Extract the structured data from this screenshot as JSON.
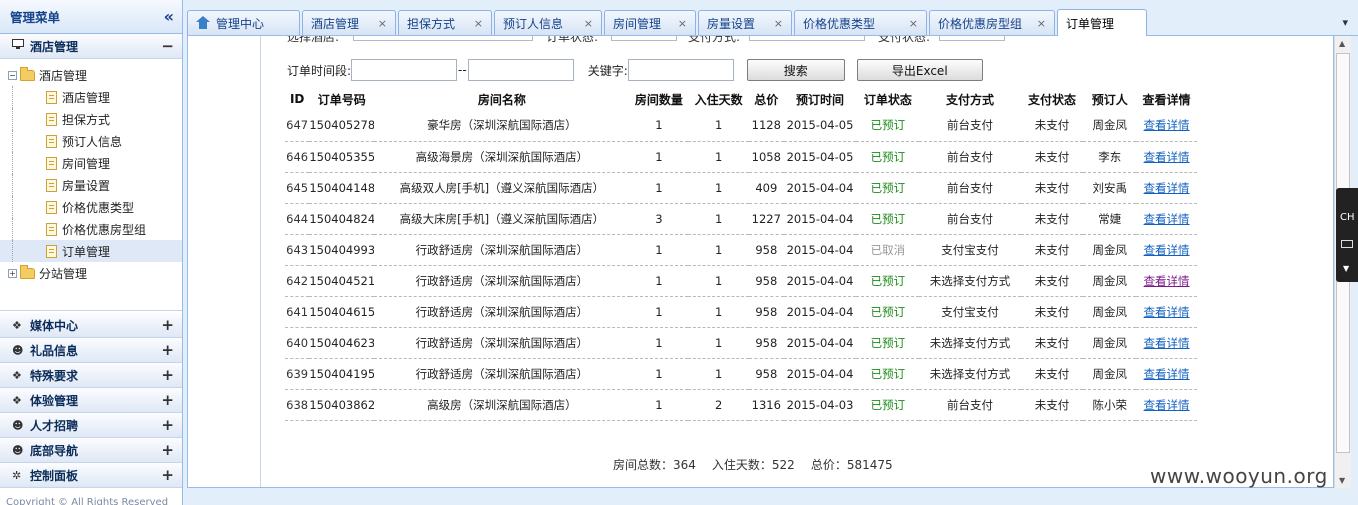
{
  "sidebar": {
    "title": "管理菜单",
    "collapse_glyph": "«",
    "active_section": {
      "label": "酒店管理",
      "toggle": "−"
    },
    "tree": {
      "root": {
        "label": "酒店管理",
        "expander": "−"
      },
      "children": [
        "酒店管理",
        "担保方式",
        "预订人信息",
        "房间管理",
        "房量设置",
        "价格优惠类型",
        "价格优惠房型组",
        "订单管理"
      ],
      "selected": "订单管理",
      "sibling": {
        "label": "分站管理",
        "expander": "+"
      }
    },
    "sections": [
      {
        "label": "媒体中心",
        "icon": "bird-icon",
        "toggle": "+"
      },
      {
        "label": "礼品信息",
        "icon": "users-icon",
        "toggle": "+"
      },
      {
        "label": "特殊要求",
        "icon": "bird-icon",
        "toggle": "+"
      },
      {
        "label": "体验管理",
        "icon": "bird-icon",
        "toggle": "+"
      },
      {
        "label": "人才招聘",
        "icon": "users-icon",
        "toggle": "+"
      },
      {
        "label": "底部导航",
        "icon": "users-icon",
        "toggle": "+"
      },
      {
        "label": "控制面板",
        "icon": "gear-icon",
        "toggle": "+"
      }
    ],
    "copyright": "Copyright © All Rights Reserved"
  },
  "tabs": {
    "items": [
      "管理中心",
      "酒店管理",
      "担保方式",
      "预订人信息",
      "房间管理",
      "房量设置",
      "价格优惠类型",
      "价格优惠房型组",
      "订单管理"
    ],
    "active": "订单管理",
    "close_glyph": "×",
    "more_glyph": "¥"
  },
  "filters": {
    "top_row_labels": [
      "选择酒店:",
      "订单状态:",
      "支付方式:",
      "支付状态:"
    ],
    "time_label": "订单时间段:",
    "range_sep": "--",
    "keyword_label": "关键字:",
    "search_button": "搜索",
    "export_button": "导出Excel"
  },
  "grid": {
    "columns": [
      "ID",
      "订单号码",
      "房间名称",
      "房间数量",
      "入住天数",
      "总价",
      "预订时间",
      "订单状态",
      "支付方式",
      "支付状态",
      "预订人",
      "查看详情"
    ],
    "rows": [
      [
        "647",
        "150405278",
        "豪华房（深圳深航国际酒店）",
        "1",
        "1",
        "1128",
        "2015-04-05",
        "已预订",
        "前台支付",
        "未支付",
        "周金凤",
        "查看详情"
      ],
      [
        "646",
        "150405355",
        "高级海景房（深圳深航国际酒店）",
        "1",
        "1",
        "1058",
        "2015-04-05",
        "已预订",
        "前台支付",
        "未支付",
        "李东",
        "查看详情"
      ],
      [
        "645",
        "150404148",
        "高级双人房[手机]（遵义深航国际酒店）",
        "1",
        "1",
        "409",
        "2015-04-04",
        "已预订",
        "前台支付",
        "未支付",
        "刘安禹",
        "查看详情"
      ],
      [
        "644",
        "150404824",
        "高级大床房[手机]（遵义深航国际酒店）",
        "3",
        "1",
        "1227",
        "2015-04-04",
        "已预订",
        "前台支付",
        "未支付",
        "常婕",
        "查看详情"
      ],
      [
        "643",
        "150404993",
        "行政舒适房（深圳深航国际酒店）",
        "1",
        "1",
        "958",
        "2015-04-04",
        "已取消",
        "支付宝支付",
        "未支付",
        "周金凤",
        "查看详情"
      ],
      [
        "642",
        "150404521",
        "行政舒适房（深圳深航国际酒店）",
        "1",
        "1",
        "958",
        "2015-04-04",
        "已预订",
        "未选择支付方式",
        "未支付",
        "周金凤",
        "查看详情"
      ],
      [
        "641",
        "150404615",
        "行政舒适房（深圳深航国际酒店）",
        "1",
        "1",
        "958",
        "2015-04-04",
        "已预订",
        "支付宝支付",
        "未支付",
        "周金凤",
        "查看详情"
      ],
      [
        "640",
        "150404623",
        "行政舒适房（深圳深航国际酒店）",
        "1",
        "1",
        "958",
        "2015-04-04",
        "已预订",
        "未选择支付方式",
        "未支付",
        "周金凤",
        "查看详情"
      ],
      [
        "639",
        "150404195",
        "行政舒适房（深圳深航国际酒店）",
        "1",
        "1",
        "958",
        "2015-04-04",
        "已预订",
        "未选择支付方式",
        "未支付",
        "周金凤",
        "查看详情"
      ],
      [
        "638",
        "150403862",
        "高级房（深圳深航国际酒店）",
        "1",
        "2",
        "1316",
        "2015-04-03",
        "已预订",
        "前台支付",
        "未支付",
        "陈小荣",
        "查看详情"
      ]
    ],
    "visited_row": 5
  },
  "summary": {
    "rooms": "房间总数：364",
    "nights": "入住天数：522",
    "total": "总价：581475"
  },
  "ime": {
    "label": "CH"
  },
  "watermark": "www.wooyun.org",
  "colors": {
    "booked": "#1a8a1a",
    "cancelled": "#999999",
    "link": "#1260c0",
    "link_visited": "#7a1a8a",
    "accent": "#99bbe8"
  }
}
